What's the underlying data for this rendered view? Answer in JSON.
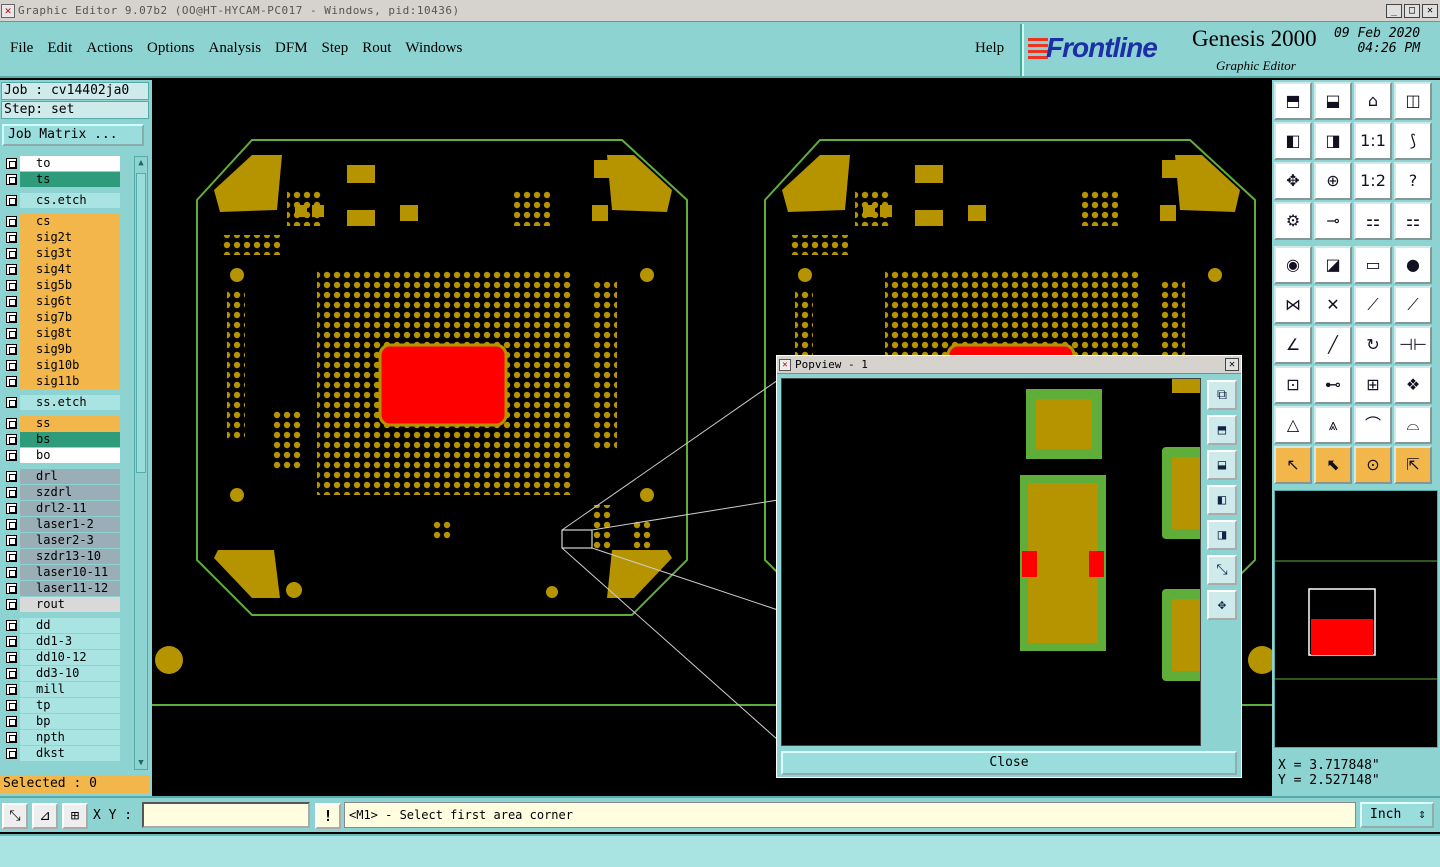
{
  "window": {
    "title": "Graphic Editor 9.07b2 (OO@HT-HYCAM-PC017 - Windows, pid:10436)",
    "controls": [
      "_",
      "□",
      "✕"
    ]
  },
  "menu": {
    "items": [
      "File",
      "Edit",
      "Actions",
      "Options",
      "Analysis",
      "DFM",
      "Step",
      "Rout",
      "Windows"
    ],
    "help": "Help"
  },
  "brand": {
    "logo_text": "Frontline",
    "product": "Genesis 2000",
    "subtitle": "Graphic Editor",
    "date": "09 Feb 2020",
    "time": "04:26 PM"
  },
  "left_panel": {
    "job": "Job : cv14402ja0",
    "step": "Step: set",
    "job_matrix_button": "Job Matrix ...",
    "selected": "Selected : 0",
    "layers": [
      {
        "name": "to",
        "bg": "#ffffff",
        "swatch": "#ffffff"
      },
      {
        "name": "ts",
        "bg": "#2e9b7a",
        "swatch": "#2e9b7a"
      },
      {
        "name": "cs.etch",
        "bg": "#a9e3e2",
        "swatch": "#a9e3e2",
        "gap": true
      },
      {
        "name": "cs",
        "bg": "#f2b64a",
        "swatch": "#f2b64a",
        "gap": true
      },
      {
        "name": "sig2t",
        "bg": "#f2b64a",
        "swatch": "#f2b64a"
      },
      {
        "name": "sig3t",
        "bg": "#f2b64a",
        "swatch": "#f2b64a"
      },
      {
        "name": "sig4t",
        "bg": "#f2b64a",
        "swatch": "#f2b64a"
      },
      {
        "name": "sig5b",
        "bg": "#f2b64a",
        "swatch": "#f2b64a"
      },
      {
        "name": "sig6t",
        "bg": "#f2b64a",
        "swatch": "#f2b64a"
      },
      {
        "name": "sig7b",
        "bg": "#f2b64a",
        "swatch": "#f2b64a"
      },
      {
        "name": "sig8t",
        "bg": "#f2b64a",
        "swatch": "#f2b64a"
      },
      {
        "name": "sig9b",
        "bg": "#f2b64a",
        "swatch": "#f2b64a"
      },
      {
        "name": "sig10b",
        "bg": "#f2b64a",
        "swatch": "#f2b64a"
      },
      {
        "name": "sig11b",
        "bg": "#f2b64a",
        "swatch": "#f2b64a"
      },
      {
        "name": "ss.etch",
        "bg": "#a9e3e2",
        "swatch": "#a9e3e2",
        "gap": true
      },
      {
        "name": "ss",
        "bg": "#f2b64a",
        "swatch": "#f2b64a",
        "gap": true
      },
      {
        "name": "bs",
        "bg": "#2e9b7a",
        "swatch": "#2e9b7a"
      },
      {
        "name": "bo",
        "bg": "#ffffff",
        "swatch": "#ffffff"
      },
      {
        "name": "drl",
        "bg": "#9aaeb8",
        "swatch": "#9aaeb8",
        "gap": true
      },
      {
        "name": "szdrl",
        "bg": "#9aaeb8",
        "swatch": "#9aaeb8"
      },
      {
        "name": "drl2-11",
        "bg": "#9aaeb8",
        "swatch": "#9aaeb8"
      },
      {
        "name": "laser1-2",
        "bg": "#9aaeb8",
        "swatch": "#9aaeb8"
      },
      {
        "name": "laser2-3",
        "bg": "#9aaeb8",
        "swatch": "#9aaeb8"
      },
      {
        "name": "szdr13-10",
        "bg": "#9aaeb8",
        "swatch": "#9aaeb8"
      },
      {
        "name": "laser10-11",
        "bg": "#9aaeb8",
        "swatch": "#9aaeb8"
      },
      {
        "name": "laser11-12",
        "bg": "#9aaeb8",
        "swatch": "#9aaeb8"
      },
      {
        "name": "rout",
        "bg": "#d9d9d9",
        "swatch": "#d9d9d9"
      },
      {
        "name": "dd",
        "bg": "#a9e3e2",
        "swatch": "#a9e3e2",
        "gap": true
      },
      {
        "name": "dd1-3",
        "bg": "#a9e3e2",
        "swatch": "#a9e3e2"
      },
      {
        "name": "dd10-12",
        "bg": "#a9e3e2",
        "swatch": "#a9e3e2"
      },
      {
        "name": "dd3-10",
        "bg": "#a9e3e2",
        "swatch": "#a9e3e2"
      },
      {
        "name": "mill",
        "bg": "#a9e3e2",
        "swatch": "#a9e3e2"
      },
      {
        "name": "tp",
        "bg": "#a9e3e2",
        "swatch": "#a9e3e2"
      },
      {
        "name": "bp",
        "bg": "#a9e3e2",
        "swatch": "#a9e3e2"
      },
      {
        "name": "npth",
        "bg": "#a9e3e2",
        "swatch": "#a9e3e2"
      },
      {
        "name": "dkst",
        "bg": "#a9e3e2",
        "swatch": "#a9e3e2"
      }
    ]
  },
  "popview": {
    "title": "Popview - 1",
    "close_label": "Close",
    "tools": [
      "zoom-fit-icon",
      "pan-up-icon",
      "pan-down-icon",
      "pan-left-icon",
      "pan-right-icon",
      "zoom-out-icon",
      "zoom-in-icon"
    ]
  },
  "right_panel": {
    "coord_x": "X = 3.717848\"",
    "coord_y": "Y = 2.527148\"",
    "tools": [
      {
        "icon": "zoom-home-icon",
        "glyph": "⬒"
      },
      {
        "icon": "zoom-down-icon",
        "glyph": "⬓"
      },
      {
        "icon": "home-icon",
        "glyph": "⌂"
      },
      {
        "icon": "zoom-window-icon",
        "glyph": "◫"
      },
      {
        "icon": "pan-left-icon",
        "glyph": "◧"
      },
      {
        "icon": "pan-right-icon",
        "glyph": "◨"
      },
      {
        "icon": "one-to-one-icon",
        "glyph": "1:1"
      },
      {
        "icon": "snap-icon",
        "glyph": "⟆"
      },
      {
        "icon": "fit-all-icon",
        "glyph": "✥"
      },
      {
        "icon": "center-icon",
        "glyph": "⊕"
      },
      {
        "icon": "scale-1-2-icon",
        "glyph": "1:2"
      },
      {
        "icon": "help-icon",
        "glyph": "?"
      },
      {
        "icon": "filter-icon",
        "glyph": "⚙"
      },
      {
        "icon": "key-icon",
        "glyph": "⊸"
      },
      {
        "icon": "layer-on-icon",
        "glyph": "⚏"
      },
      {
        "icon": "layer-off-icon",
        "glyph": "⚏"
      },
      {
        "icon": "add-feature-icon",
        "glyph": "◉"
      },
      {
        "icon": "select-area-icon",
        "glyph": "◪"
      },
      {
        "icon": "measure-icon",
        "glyph": "▭"
      },
      {
        "icon": "pad-icon",
        "glyph": "●"
      },
      {
        "icon": "connect-icon",
        "glyph": "⋈"
      },
      {
        "icon": "cross-icon",
        "glyph": "✕"
      },
      {
        "icon": "node-icon",
        "glyph": "⟋"
      },
      {
        "icon": "node-move-icon",
        "glyph": "⟋"
      },
      {
        "icon": "angle-icon",
        "glyph": "∠"
      },
      {
        "icon": "line-icon",
        "glyph": "╱"
      },
      {
        "icon": "rotate-icon",
        "glyph": "↻"
      },
      {
        "icon": "mirror-icon",
        "glyph": "⊣⊢"
      },
      {
        "icon": "origin-icon",
        "glyph": "⊡"
      },
      {
        "icon": "center-line-icon",
        "glyph": "⊷"
      },
      {
        "icon": "datum-icon",
        "glyph": "⊞"
      },
      {
        "icon": "group-icon",
        "glyph": "❖"
      },
      {
        "icon": "poly-icon",
        "glyph": "△"
      },
      {
        "icon": "poly-edit-icon",
        "glyph": "⩓"
      },
      {
        "icon": "arc-icon",
        "glyph": "⌒"
      },
      {
        "icon": "slot-icon",
        "glyph": "⌓"
      },
      {
        "icon": "pointer-icon",
        "glyph": "↖"
      },
      {
        "icon": "pointer-box-icon",
        "glyph": "⬉"
      },
      {
        "icon": "pointer-circle-icon",
        "glyph": "⊙"
      },
      {
        "icon": "pointer-net-icon",
        "glyph": "⇱"
      }
    ]
  },
  "bottom_bar": {
    "xy_label": "X Y :",
    "xy_value": "",
    "warning_icon": "!",
    "message": "<M1> - Select first area corner",
    "units": "Inch"
  },
  "colors": {
    "panel": "#8dd3d2",
    "copper": "#b59400",
    "outline_green": "#5fae3a",
    "pad_red": "#ff0000"
  }
}
